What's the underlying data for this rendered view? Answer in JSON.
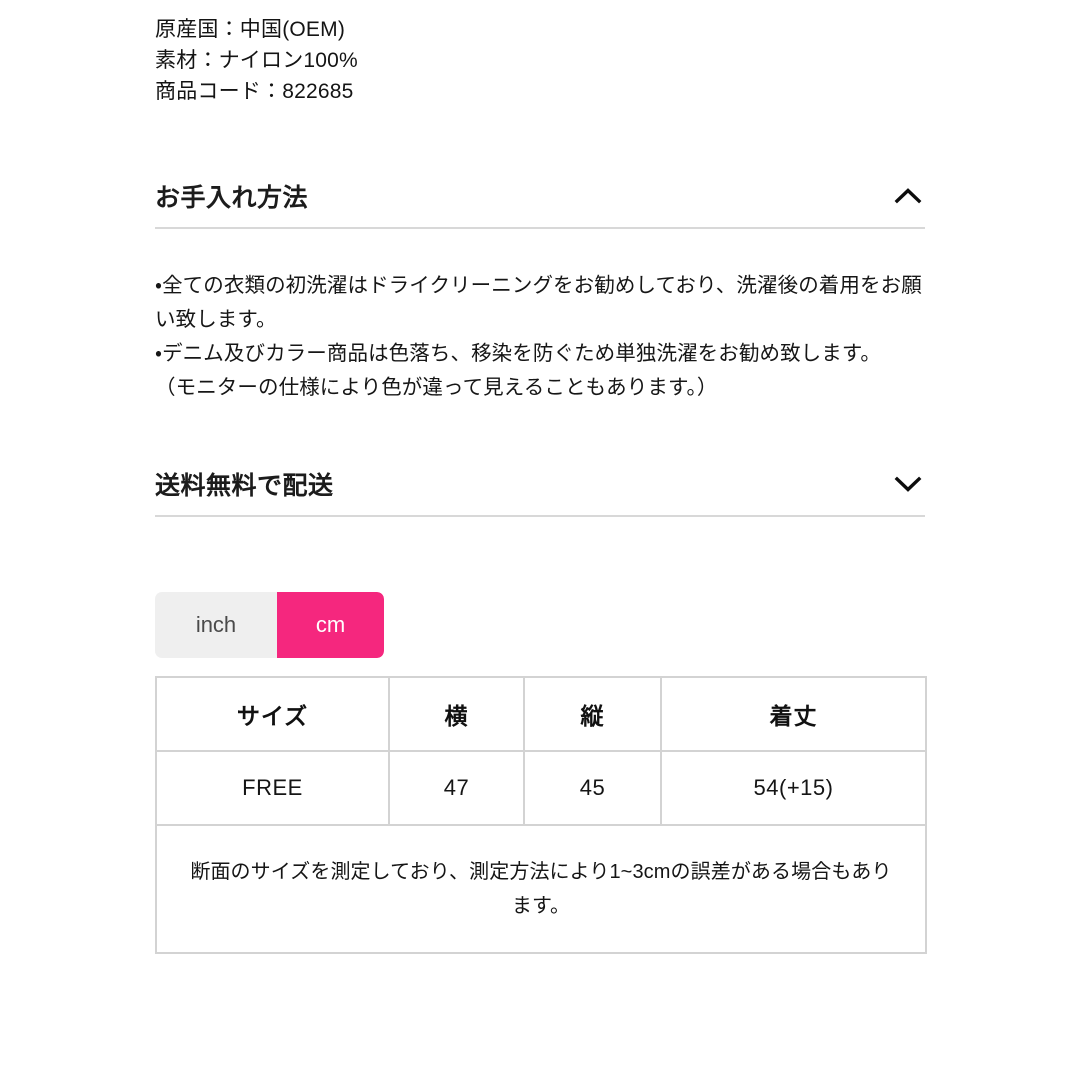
{
  "product_meta": {
    "lines": [
      "原産国：中国(OEM)",
      "素材：ナイロン100%",
      "商品コード：822685"
    ]
  },
  "sections": [
    {
      "title": "お手入れ方法",
      "expanded": true,
      "icon": "chevron-up-icon",
      "body_lines": [
        "・全ての衣類の初洗濯はドライクリーニングをお勧めしており、洗濯後の着用をお願い致します。",
        "・デニム及びカラー商品は色落ち、移染を防ぐため単独洗濯をお勧め致します。",
        "（モニターの仕様により色が違って見えることもあります。）"
      ]
    },
    {
      "title": "送料無料で配送",
      "expanded": false,
      "icon": "chevron-down-icon",
      "body_lines": []
    }
  ],
  "unit_toggle": {
    "inch_label": "inch",
    "cm_label": "cm",
    "selected": "cm",
    "active_color": "#f5277e",
    "inactive_color": "#efefef"
  },
  "size_table": {
    "headers": [
      "サイズ",
      "横",
      "縦",
      "着丈"
    ],
    "rows": [
      [
        "FREE",
        "47",
        "45",
        "54(+15)"
      ]
    ],
    "note": "断面のサイズを測定しており、測定方法により1~3cmの誤差がある場合もあります。"
  }
}
